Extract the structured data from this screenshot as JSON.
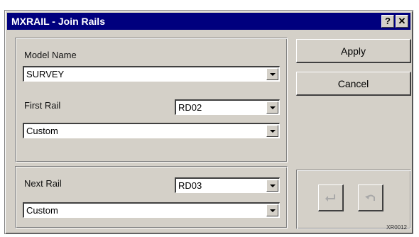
{
  "window": {
    "title": "MXRAIL - Join Rails",
    "help_label": "?",
    "close_label": "✕"
  },
  "model_section": {
    "model_name_label": "Model Name",
    "model_name_value": "SURVEY",
    "first_rail_label": "First Rail",
    "first_rail_value": "RD02",
    "first_rail_type_value": "Custom"
  },
  "next_section": {
    "next_rail_label": "Next Rail",
    "next_rail_value": "RD03",
    "next_rail_type_value": "Custom"
  },
  "buttons": {
    "apply_label": "Apply",
    "cancel_label": "Cancel"
  },
  "icons": {
    "return": "return-arrow-icon",
    "undo": "undo-icon"
  },
  "footer": {
    "code": "XR0012"
  }
}
